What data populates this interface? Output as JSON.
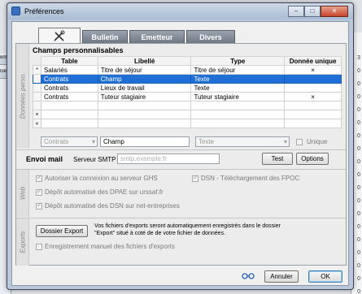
{
  "window": {
    "title": "Préférences",
    "minimize": "–",
    "maximize": "□",
    "close": "✕"
  },
  "background": {
    "left_items": [
      "ermit",
      "Gén"
    ],
    "right_numbers": [
      "3",
      "0",
      "0",
      "0",
      "0",
      "0",
      "0",
      "0",
      "0",
      "0",
      "0",
      "0",
      "0",
      "0",
      "0",
      "0",
      "0",
      "0",
      "0",
      "0"
    ]
  },
  "tabs": {
    "icon_tab": "",
    "items": [
      {
        "label": "Bulletin"
      },
      {
        "label": "Emetteur"
      },
      {
        "label": "Divers"
      }
    ]
  },
  "donnees": {
    "side_label": "Données perso.",
    "title": "Champs personnalisables",
    "columns": [
      "Table",
      "Libellé",
      "Type",
      "Donnée unique"
    ],
    "rows": [
      {
        "ind": "*",
        "table": "Salariés",
        "libelle": "Titre de séjour",
        "type": "Titre de séjour",
        "unique": "×"
      },
      {
        "ind": "",
        "table": "Contrats",
        "libelle": "Champ",
        "type": "Texte",
        "unique": ""
      },
      {
        "ind": "",
        "table": "Contrats",
        "libelle": "Lieux de travail",
        "type": "Texte",
        "unique": ""
      },
      {
        "ind": "",
        "table": "Contrats",
        "libelle": "Tuteur stagiaire",
        "type": "Tuteur stagiaire",
        "unique": "×"
      },
      {
        "ind": "",
        "table": "",
        "libelle": "",
        "type": "",
        "unique": ""
      },
      {
        "ind": "×",
        "table": "",
        "libelle": "",
        "type": "",
        "unique": ""
      },
      {
        "ind": "«",
        "table": "",
        "libelle": "",
        "type": "",
        "unique": ""
      }
    ],
    "edit_table": "Contrats",
    "edit_libelle": "Champ",
    "edit_type": "Texte",
    "unique_label": "Unique"
  },
  "mail": {
    "title": "Envoi mail",
    "smtp_label": "Serveur SMTP",
    "smtp_placeholder": "smtp.exemple.fr",
    "test_button": "Test",
    "options_button": "Options"
  },
  "web": {
    "side_label": "Web",
    "opt1": "Autoriser la connexion au serveur GHS",
    "opt2": "DSN - Téléchargement des FPOC",
    "opt3": "Dépôt automatisé des DPAE sur urssaf.fr",
    "opt4": "Dépôt automatisé des DSN sur net-entreprises"
  },
  "exports": {
    "side_label": "Exports",
    "button": "Dossier Export",
    "info": "Vos fichiers d'exports seront automatiquement enregistrés dans le dossier \"Export\" situé à coté de de votre fichier de données.",
    "manual": "Enregistrement manuel des fichiers d'exports"
  },
  "footer": {
    "cancel": "Annuler",
    "ok": "OK",
    "glasses_icon": "glasses-icon"
  }
}
